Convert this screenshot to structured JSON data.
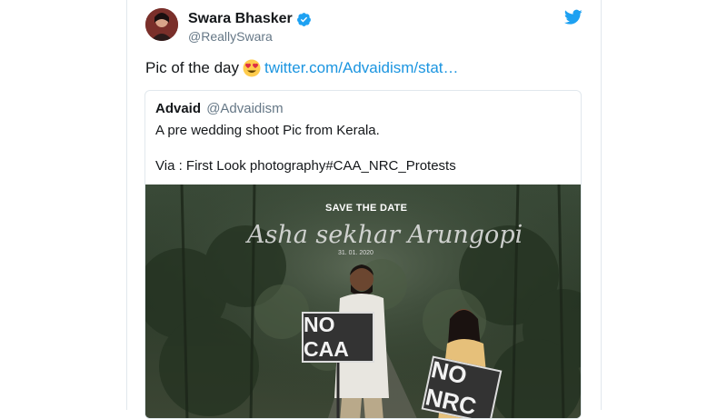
{
  "tweet": {
    "author_name": "Swara Bhasker",
    "author_handle": "@ReallySwara",
    "text_prefix": "Pic of the day",
    "emoji": "heart-eyes-emoji",
    "link_text": "twitter.com/Advaidism/stat…"
  },
  "quoted": {
    "author_name": "Advaid",
    "author_handle": "@Advaidism",
    "line1": "A pre wedding shoot Pic from Kerala.",
    "line2": "Via : First Look photography#CAA_NRC_Protests"
  },
  "photo": {
    "save_the_date": "SAVE THE DATE",
    "script_names": "Asha sekhar Arungopi",
    "date_text": "31. 01. 2020",
    "sign_left": "NO CAA",
    "sign_right": "NO NRC"
  },
  "colors": {
    "link": "#1b95e0",
    "verified": "#1da1f2",
    "twitter_bird": "#1da1f2"
  }
}
